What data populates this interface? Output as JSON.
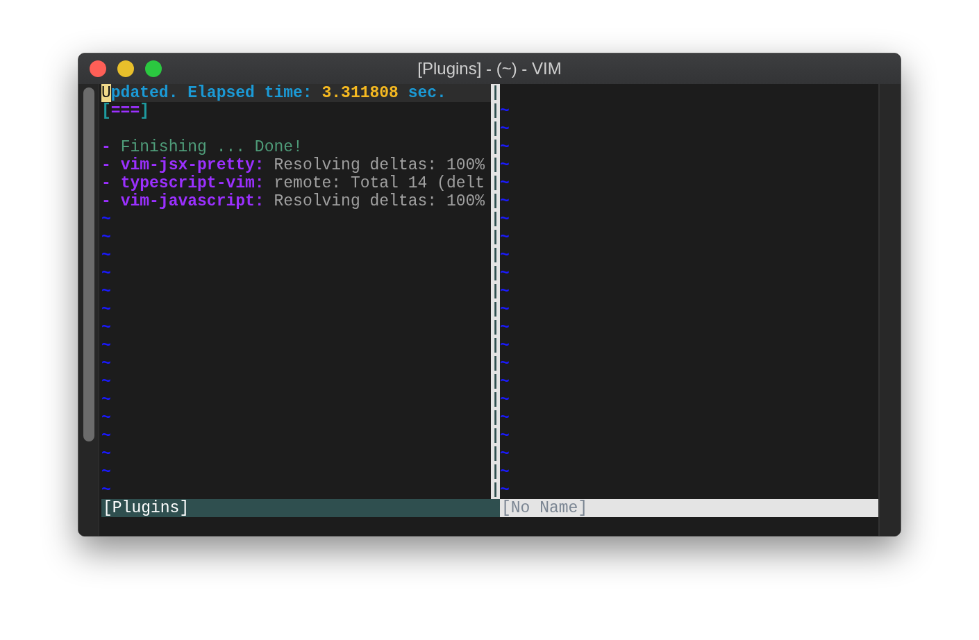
{
  "window": {
    "title": "[Plugins] - (~) - VIM"
  },
  "left_pane": {
    "header": {
      "cursor": "U",
      "label": "pdated. Elapsed time: ",
      "value": "3.311808",
      "unit": " sec."
    },
    "progress": {
      "open": "[",
      "bar": "===",
      "close": "]"
    },
    "log": [
      {
        "kind": "status",
        "bullet": "-",
        "message": "Finishing ... Done!"
      },
      {
        "kind": "plugin",
        "bullet": "-",
        "name": "vim-jsx-pretty:",
        "message": "Resolving deltas: 100%"
      },
      {
        "kind": "plugin",
        "bullet": "-",
        "name": "typescript-vim:",
        "message": "remote: Total 14 (delt"
      },
      {
        "kind": "plugin",
        "bullet": "-",
        "name": "vim-javascript:",
        "message": "Resolving deltas: 100%"
      }
    ],
    "filler": [
      "~",
      "~",
      "~",
      "~",
      "~",
      "~",
      "~",
      "~",
      "~",
      "~",
      "~",
      "~",
      "~",
      "~",
      "~",
      "~"
    ]
  },
  "separator": [
    "|",
    "|",
    "|",
    "|",
    "|",
    "|",
    "|",
    "|",
    "|",
    "|",
    "|",
    "|",
    "|",
    "|",
    "|",
    "|",
    "|",
    "|",
    "|",
    "|",
    "|",
    "|",
    "|"
  ],
  "right_pane": {
    "filler": [
      "~",
      "~",
      "~",
      "~",
      "~",
      "~",
      "~",
      "~",
      "~",
      "~",
      "~",
      "~",
      "~",
      "~",
      "~",
      "~",
      "~",
      "~",
      "~",
      "~",
      "~",
      "~"
    ]
  },
  "status_lines": [
    {
      "label": "[Plugins]",
      "selected": true
    },
    {
      "label": "[No Name]",
      "selected": false
    }
  ]
}
